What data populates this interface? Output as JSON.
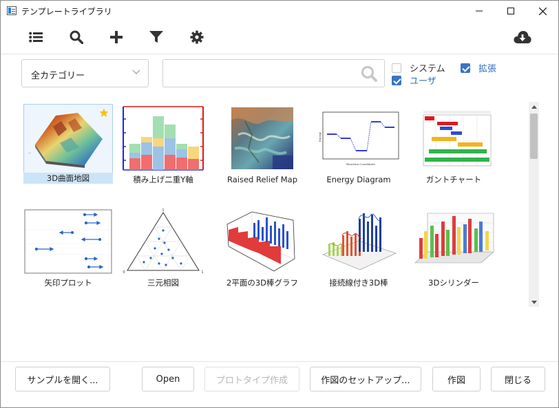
{
  "window": {
    "title": "テンプレートライブラリ"
  },
  "toolbar": {
    "icons": [
      "list-icon",
      "search-icon",
      "add-icon",
      "filter-icon",
      "gear-icon",
      "cloud-download-icon"
    ]
  },
  "filters": {
    "category": "全カテゴリー",
    "search_value": "",
    "checkboxes": [
      {
        "label": "システム",
        "checked": false
      },
      {
        "label": "拡張",
        "checked": true
      },
      {
        "label": "ユーザ",
        "checked": true
      }
    ]
  },
  "templates": [
    {
      "label": "3D曲面地図",
      "selected": true,
      "favorite": true
    },
    {
      "label": "積み上げ二重Y軸",
      "selected": false,
      "favorite": false
    },
    {
      "label": "Raised Relief Map",
      "selected": false,
      "favorite": false
    },
    {
      "label": "Energy Diagram",
      "selected": false,
      "favorite": false
    },
    {
      "label": "ガントチャート",
      "selected": false,
      "favorite": false
    },
    {
      "label": "矢印プロット",
      "selected": false,
      "favorite": false
    },
    {
      "label": "三元相図",
      "selected": false,
      "favorite": false
    },
    {
      "label": "2平面の3D棒グラフ",
      "selected": false,
      "favorite": false
    },
    {
      "label": "接続線付き3D棒",
      "selected": false,
      "favorite": false
    },
    {
      "label": "3Dシリンダー",
      "selected": false,
      "favorite": false
    }
  ],
  "thumb_text": {
    "ternary_top": "1",
    "ternary_left": "0",
    "ternary_right": "1",
    "energy_xlabel": "Reaction Coordinate",
    "energy_ylabel": "Energy"
  },
  "buttons": {
    "open_sample": "サンプルを開く...",
    "open": "Open",
    "prototype": "プロトタイプ作成",
    "setup": "作図のセットアップ...",
    "plot": "作図",
    "close": "閉じる"
  },
  "colors": {
    "accent": "#3b74c4",
    "selection": "#cce4f7"
  }
}
